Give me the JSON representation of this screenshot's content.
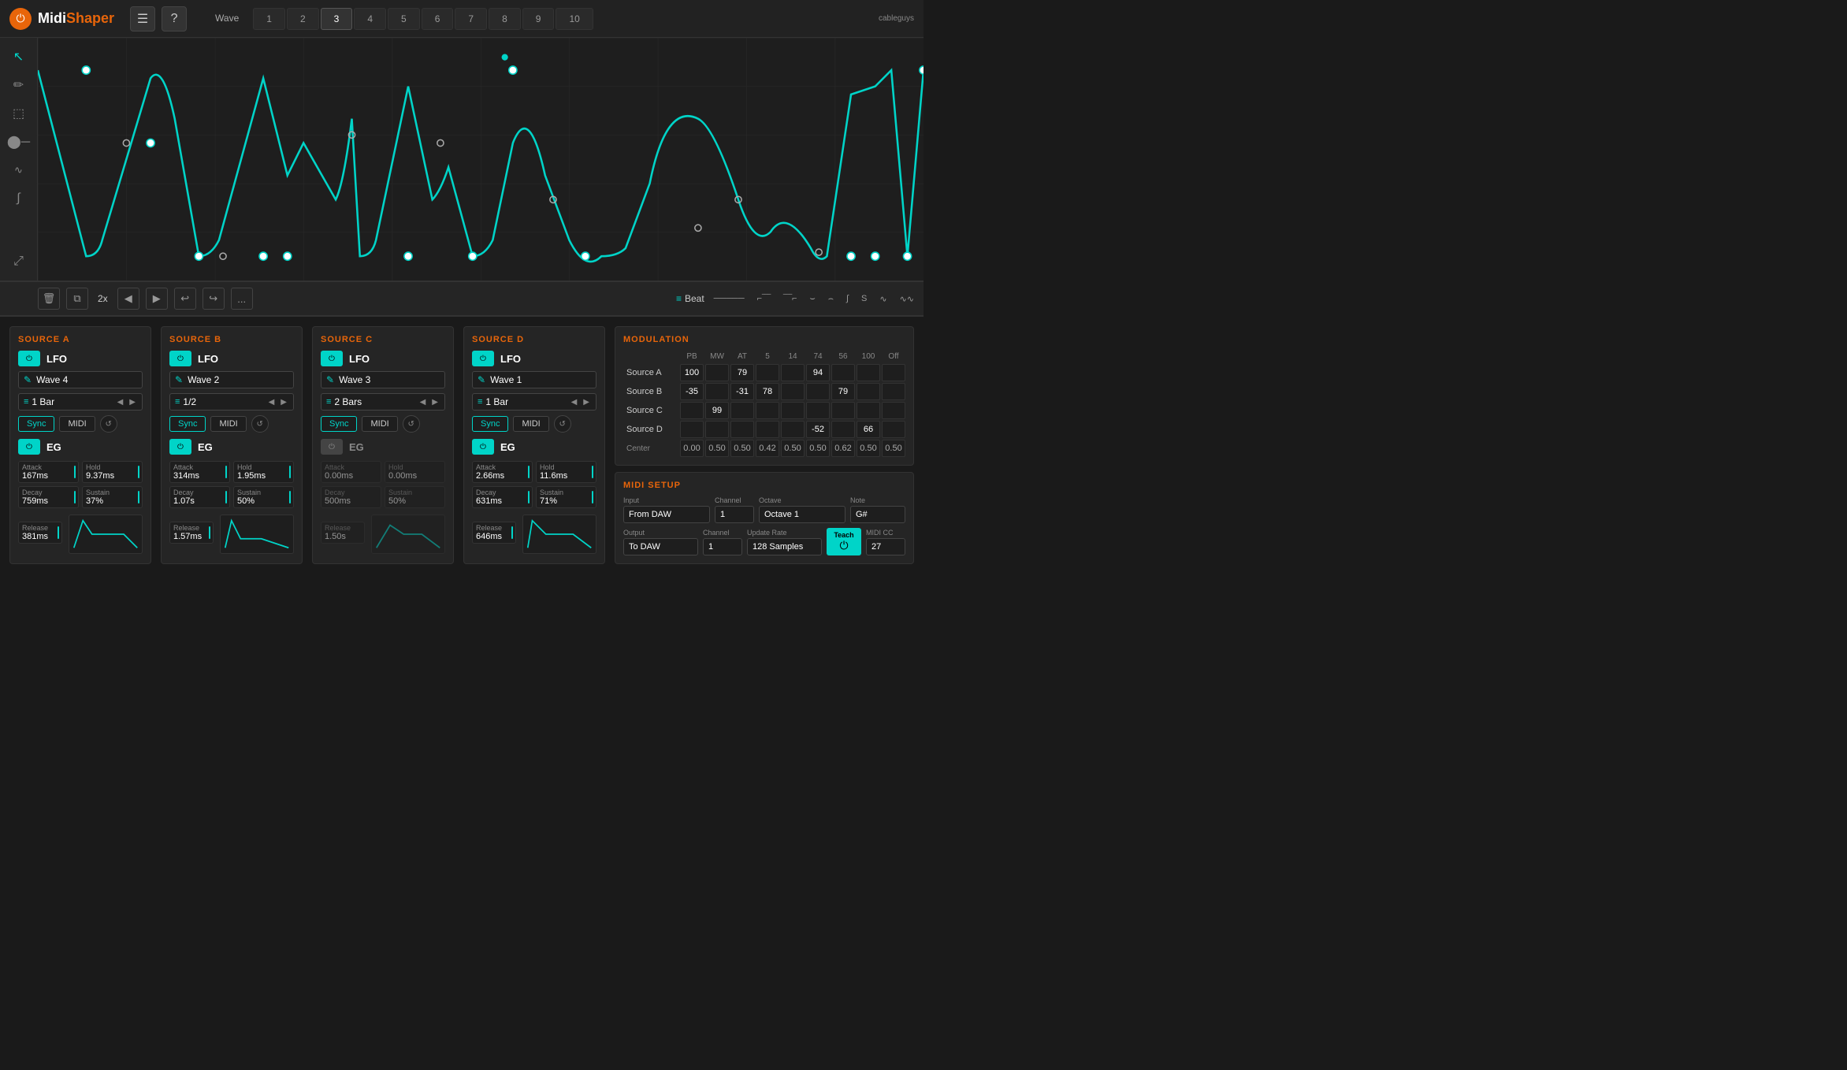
{
  "header": {
    "logo": "MidiShaper",
    "logo_midi": "Midi",
    "logo_shaper": "Shaper",
    "power_icon": "⏻",
    "menu_icon": "☰",
    "help_icon": "?",
    "cableguys": "cableguys",
    "wave_label": "Wave",
    "tabs": [
      "1",
      "2",
      "3",
      "4",
      "5",
      "6",
      "7",
      "8",
      "9",
      "10"
    ],
    "active_tab": "3"
  },
  "toolbar": {
    "zoom": "2x",
    "beat_icon": "≡",
    "beat_label": "Beat",
    "more_icon": "..."
  },
  "sources": {
    "a": {
      "title": "SOURCE A",
      "lfo_label": "LFO",
      "lfo_on": true,
      "wave_name": "Wave 4",
      "bar": "1 Bar",
      "sync": "Sync",
      "midi": "MIDI",
      "eg_label": "EG",
      "eg_on": true,
      "attack": "167ms",
      "hold": "9.37ms",
      "decay": "759ms",
      "sustain": "37%",
      "release": "381ms"
    },
    "b": {
      "title": "SOURCE B",
      "lfo_label": "LFO",
      "lfo_on": true,
      "wave_name": "Wave 2",
      "bar": "1/2",
      "sync": "Sync",
      "midi": "MIDI",
      "eg_label": "EG",
      "eg_on": true,
      "attack": "314ms",
      "hold": "1.95ms",
      "decay": "1.07s",
      "sustain": "50%",
      "release": "1.57ms"
    },
    "c": {
      "title": "SOURCE C",
      "lfo_label": "LFO",
      "lfo_on": true,
      "wave_name": "Wave 3",
      "bar": "2 Bars",
      "sync": "Sync",
      "midi": "MIDI",
      "eg_label": "EG",
      "eg_on": false,
      "attack": "0.00ms",
      "hold": "0.00ms",
      "decay": "500ms",
      "sustain": "50%",
      "release": "1.50s"
    },
    "d": {
      "title": "SOURCE D",
      "lfo_label": "LFO",
      "lfo_on": true,
      "wave_name": "Wave 1",
      "bar": "1 Bar",
      "sync": "Sync",
      "midi": "MIDI",
      "eg_label": "EG",
      "eg_on": true,
      "attack": "2.66ms",
      "hold": "11.6ms",
      "decay": "631ms",
      "sustain": "71%",
      "release": "646ms"
    }
  },
  "modulation": {
    "title": "MODULATION",
    "headers": [
      "PB",
      "MW",
      "AT",
      "5",
      "14",
      "74",
      "56",
      "100",
      "Off"
    ],
    "rows": [
      {
        "label": "Source A",
        "values": [
          "100",
          "",
          "79",
          "",
          "",
          "94",
          "",
          "",
          ""
        ]
      },
      {
        "label": "Source B",
        "values": [
          "-35",
          "",
          "-31",
          "78",
          "",
          "",
          "79",
          "",
          ""
        ]
      },
      {
        "label": "Source C",
        "values": [
          "",
          "99",
          "",
          "",
          "",
          "",
          "",
          "",
          ""
        ]
      },
      {
        "label": "Source D",
        "values": [
          "",
          "",
          "",
          "",
          "",
          "-52",
          "",
          "66",
          ""
        ]
      }
    ],
    "center_label": "Center",
    "center_values": [
      "0.00",
      "0.50",
      "0.50",
      "0.42",
      "0.50",
      "0.50",
      "0.62",
      "0.50",
      "0.50"
    ]
  },
  "midi_setup": {
    "title": "MIDI SETUP",
    "input_label": "Input",
    "input_value": "From DAW",
    "input_channel_label": "Channel",
    "input_channel": "1",
    "octave_label": "Octave",
    "octave_value": "Octave 1",
    "note_label": "Note",
    "note_value": "G#",
    "output_label": "Output",
    "output_value": "To DAW",
    "output_channel_label": "Channel",
    "output_channel": "1",
    "update_rate_label": "Update Rate",
    "update_rate_value": "128 Samples",
    "teach_label": "Teach",
    "midi_cc_label": "MIDI CC",
    "midi_cc_value": "27"
  }
}
